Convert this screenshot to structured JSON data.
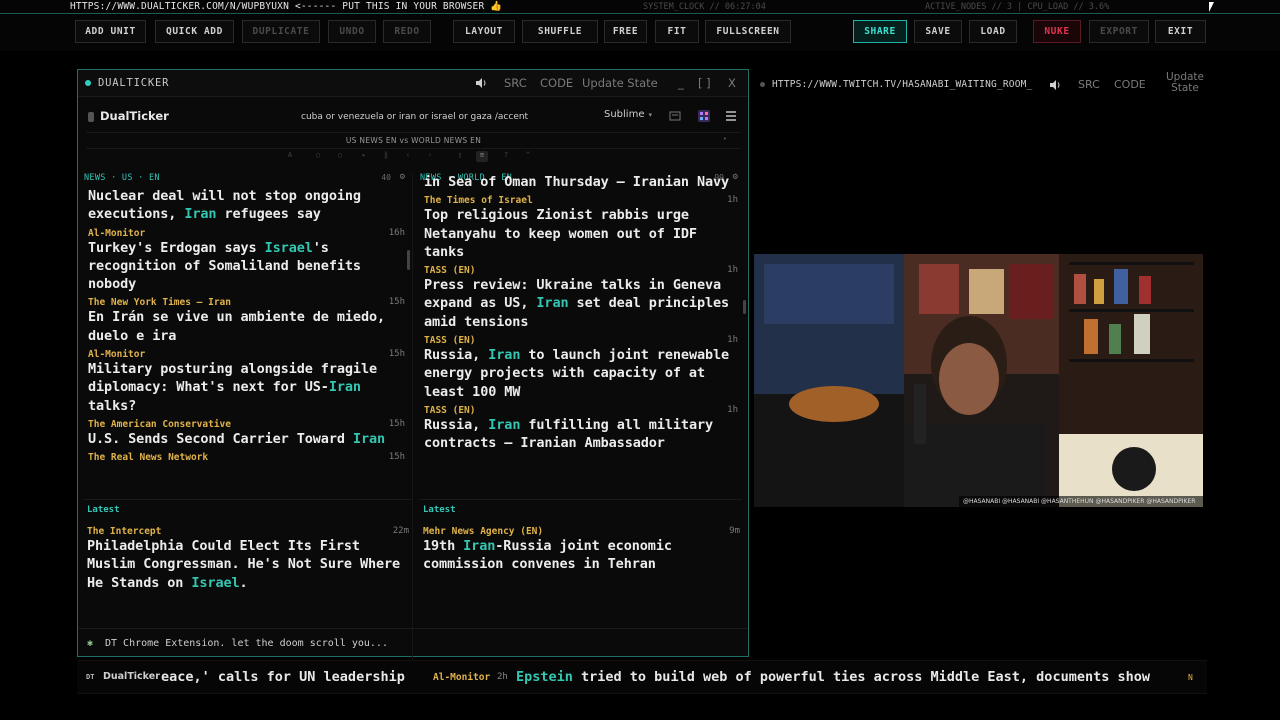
{
  "topbar": {
    "url_banner": "HTTPS://WWW.DUALTICKER.COM/N/WUPBYUXN <------ PUT THIS IN YOUR BROWSER 👍",
    "system_clock": "SYSTEM_CLOCK // 06:27:04",
    "system_stats": "ACTIVE_NODES // 3 | CPU_LOAD // 3.6%"
  },
  "toolbar": {
    "add_unit": "ADD UNIT",
    "quick_add": "QUICK ADD",
    "duplicate": "DUPLICATE",
    "undo": "UNDO",
    "redo": "REDO",
    "layout": "LAYOUT",
    "shuffle": "SHUFFLE",
    "free": "FREE",
    "fit": "FIT",
    "fullscreen": "FULLSCREEN",
    "share": "SHARE",
    "save": "SAVE",
    "load": "LOAD",
    "nuke": "NUKE",
    "export": "EXPORT",
    "exit": "EXIT"
  },
  "left_window": {
    "title": "DUALTICKER",
    "src": "SRC",
    "code": "CODE",
    "update_state": "Update State",
    "minimize": "_",
    "maximize": "[ ]",
    "close": "X"
  },
  "app": {
    "brand": "DualTicker",
    "search_value": "cuba or venezuela or iran or israel or gaza /accent",
    "theme": "Sublime",
    "compare_label": "US NEWS EN vs WORLD NEWS EN"
  },
  "columns": {
    "left": {
      "tag": "NEWS · US · EN",
      "count": "40",
      "items": [
        {
          "source": "",
          "age": "",
          "parts": [
            "Nuclear deal will not stop ongoing executions, ",
            "Iran",
            " refugees say"
          ]
        },
        {
          "source": "Al-Monitor",
          "age": "16h",
          "parts": [
            "Turkey's Erdogan says ",
            "Israel",
            "'s recognition of Somaliland benefits nobody",
            "",
            ""
          ]
        },
        {
          "source": "The New York Times — Iran",
          "age": "15h",
          "parts": [
            "En Irán se vive un ambiente de miedo, duelo e ira",
            "",
            ""
          ]
        },
        {
          "source": "Al-Monitor",
          "age": "15h",
          "parts": [
            "Military posturing alongside fragile diplomacy: What's next for US-",
            "Iran",
            " talks?"
          ]
        },
        {
          "source": "The American Conservative",
          "age": "15h",
          "parts": [
            "U.S. Sends Second Carrier Toward ",
            "Iran",
            ""
          ]
        },
        {
          "source": "The Real News Network",
          "age": "15h",
          "parts": [
            "",
            "",
            ""
          ]
        }
      ]
    },
    "right": {
      "tag": "NEWS · WORLD · EN",
      "count": "99",
      "items": [
        {
          "source": "",
          "age": "",
          "parts": [
            "in Sea of Oman Thursday — Iranian Navy",
            "",
            ""
          ]
        },
        {
          "source": "The Times of Israel",
          "age": "1h",
          "parts": [
            "Top religious Zionist rabbis urge Netanyahu to keep women out of IDF tanks",
            "",
            ""
          ]
        },
        {
          "source": "TASS (EN)",
          "age": "1h",
          "parts": [
            "Press review: Ukraine talks in Geneva expand as US, ",
            "Iran",
            " set deal principles amid tensions"
          ]
        },
        {
          "source": "TASS (EN)",
          "age": "1h",
          "parts": [
            "Russia, ",
            "Iran",
            " to launch joint renewable energy projects with capacity of at least 100 MW"
          ]
        },
        {
          "source": "TASS (EN)",
          "age": "1h",
          "parts": [
            "Russia, ",
            "Iran",
            " fulfilling all military contracts — Iranian Ambassador"
          ]
        }
      ]
    }
  },
  "latest": {
    "left": {
      "label": "Latest",
      "source": "The Intercept",
      "age": "22m",
      "parts": [
        "Philadelphia Could Elect Its First Muslim Congressman. He's Not Sure Where He Stands on ",
        "Israel",
        "."
      ]
    },
    "right": {
      "label": "Latest",
      "source": "Mehr News Agency (EN)",
      "age": "9m",
      "parts": [
        "19th ",
        "Iran",
        "-Russia joint economic commission convenes in Tehran"
      ]
    }
  },
  "extension_bar": {
    "text": "DT Chrome Extension. let the doom scroll you..."
  },
  "right_panel": {
    "url": "HTTPS://WWW.TWITCH.TV/HASANABI_WAITING_ROOM_",
    "src": "SRC",
    "code": "CODE",
    "update": "Update",
    "state": "State",
    "overlay_text": "@HASANABI  @HASANABI  @HASANTHEHUN  @HASANDPIKER  @HASANDPIKER"
  },
  "ticker": {
    "badge": "DT",
    "brand": "DualTicker",
    "headline_a": "eace,' calls for UN leadership",
    "source_b": "Al-Monitor",
    "age_b": "2h",
    "headline_b_kw": "Epstein",
    "headline_b_rest": " tried to build web of powerful ties across Middle East, documents show",
    "next_marker": "N"
  },
  "colors": {
    "accent": "#2ecfc0",
    "keyword": "#33c7b3",
    "source": "#e0b24a",
    "nuke": "#e0344e",
    "background": "#000000"
  }
}
